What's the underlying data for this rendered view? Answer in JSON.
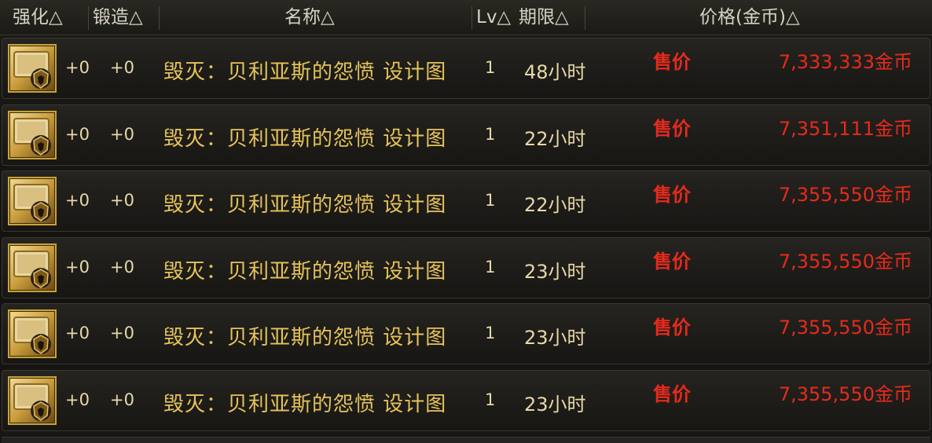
{
  "header": {
    "col_enhance": "强化△",
    "col_forge": "锻造△",
    "col_name": "名称△",
    "col_lv": "Lv△",
    "col_period": "期限△",
    "col_price": "价格(金币)△"
  },
  "colors": {
    "name": "#e6c35a",
    "price": "#e62a1c",
    "icon_border": "#c9a23a"
  },
  "rows": [
    {
      "icon": "blueprint-item-icon",
      "enhance": "+0",
      "forge": "+0",
      "name": "毁灭：贝利亚斯的怨愤  设计图",
      "lv": "1",
      "period": "48小时",
      "sale_label": "售价",
      "price": "7,333,333金币"
    },
    {
      "icon": "blueprint-item-icon",
      "enhance": "+0",
      "forge": "+0",
      "name": "毁灭：贝利亚斯的怨愤  设计图",
      "lv": "1",
      "period": "22小时",
      "sale_label": "售价",
      "price": "7,351,111金币"
    },
    {
      "icon": "blueprint-item-icon",
      "enhance": "+0",
      "forge": "+0",
      "name": "毁灭：贝利亚斯的怨愤  设计图",
      "lv": "1",
      "period": "22小时",
      "sale_label": "售价",
      "price": "7,355,550金币"
    },
    {
      "icon": "blueprint-item-icon",
      "enhance": "+0",
      "forge": "+0",
      "name": "毁灭：贝利亚斯的怨愤  设计图",
      "lv": "1",
      "period": "23小时",
      "sale_label": "售价",
      "price": "7,355,550金币"
    },
    {
      "icon": "blueprint-item-icon",
      "enhance": "+0",
      "forge": "+0",
      "name": "毁灭：贝利亚斯的怨愤  设计图",
      "lv": "1",
      "period": "23小时",
      "sale_label": "售价",
      "price": "7,355,550金币"
    },
    {
      "icon": "blueprint-item-icon",
      "enhance": "+0",
      "forge": "+0",
      "name": "毁灭：贝利亚斯的怨愤  设计图",
      "lv": "1",
      "period": "23小时",
      "sale_label": "售价",
      "price": "7,355,550金币"
    }
  ]
}
